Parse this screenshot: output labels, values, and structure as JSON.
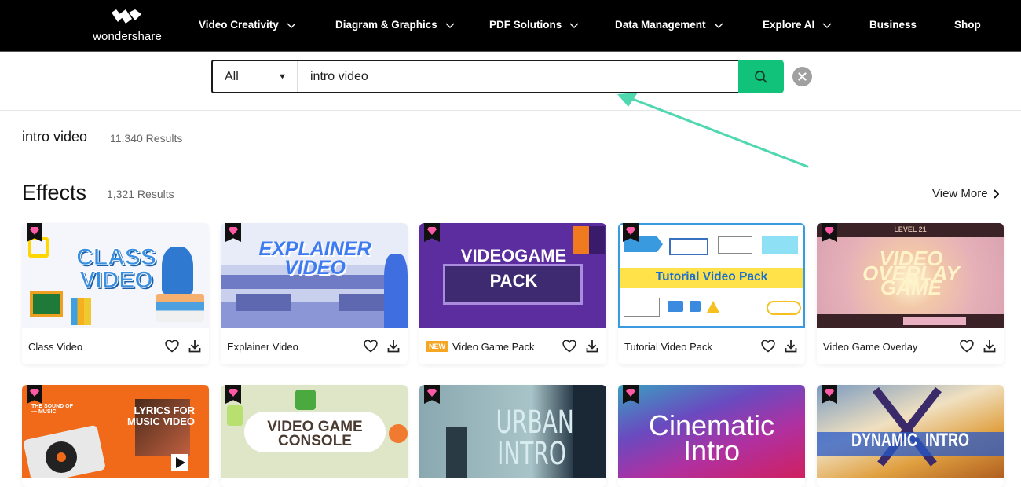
{
  "brand": {
    "name": "wondershare",
    "accent_color": "#11c27b",
    "arrow_color": "#4fd8b0"
  },
  "nav": {
    "items": [
      {
        "label": "Video Creativity",
        "has_dropdown": true
      },
      {
        "label": "Diagram & Graphics",
        "has_dropdown": true
      },
      {
        "label": "PDF Solutions",
        "has_dropdown": true
      },
      {
        "label": "Data Management",
        "has_dropdown": true
      },
      {
        "label": "Explore AI",
        "has_dropdown": true
      },
      {
        "label": "Business",
        "has_dropdown": false
      },
      {
        "label": "Shop",
        "has_dropdown": false
      }
    ]
  },
  "search": {
    "category": "All",
    "query": "intro video",
    "search_icon": "search-icon",
    "clear_icon": "close-icon"
  },
  "results": {
    "query": "intro video",
    "total": "11,340 Results"
  },
  "section": {
    "title": "Effects",
    "count": "1,321 Results",
    "view_more": "View More"
  },
  "cards_row1": [
    {
      "title": "Class Video",
      "thumb_text": "CLASS\nVIDEO",
      "is_new": false,
      "premium": true
    },
    {
      "title": "Explainer Video",
      "thumb_text": "EXPLAINER\nVIDEO",
      "is_new": false,
      "premium": true
    },
    {
      "title": "Video Game Pack",
      "thumb_text": "VIDEOGAME\nPACK",
      "is_new": true,
      "new_label": "NEW",
      "premium": true
    },
    {
      "title": "Tutorial Video Pack",
      "thumb_text": "Tutorial Video Pack",
      "is_new": false,
      "premium": true
    },
    {
      "title": "Video Game Overlay",
      "thumb_text": "VIDEO\nOVERLAY\nGAME",
      "thumb_sub": "LEVEL 21",
      "is_new": false,
      "premium": true
    }
  ],
  "cards_row2": [
    {
      "thumb_text": "LYRICS FOR\nMUSIC VIDEO",
      "thumb_sub": "THE SOUND OF — MUSIC",
      "premium": true
    },
    {
      "thumb_text": "VIDEO GAME\nCONSOLE",
      "premium": true
    },
    {
      "thumb_text": "URBAN\nINTRO",
      "premium": true
    },
    {
      "thumb_text": "Cinematic\nIntro",
      "premium": true
    },
    {
      "thumb_text": "DYNAMIC  INTRO",
      "premium": true
    }
  ]
}
